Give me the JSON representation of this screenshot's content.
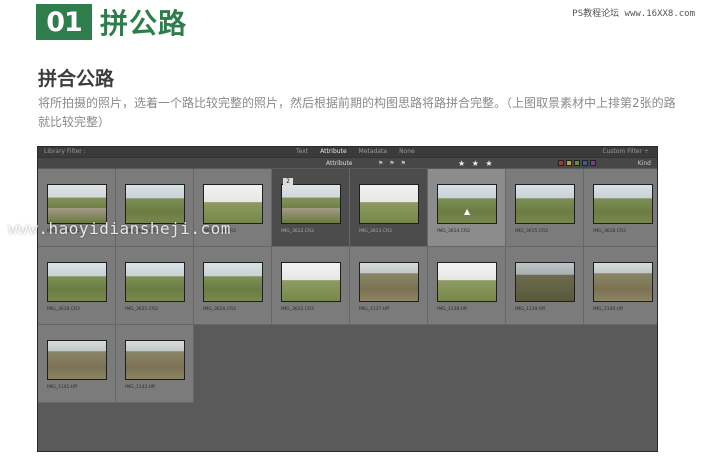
{
  "header": {
    "step_number": "01",
    "title": "拼公路",
    "accent_color": "#2f7d4c"
  },
  "watermark_top": "PS教程论坛 www.16XX8.com",
  "section": {
    "title": "拼合公路",
    "description": "将所拍摄的照片，选着一个路比较完整的照片，然后根据前期的构图思路将路拼合完整。（上图取景素材中上排第2张的路就比较完整）"
  },
  "library": {
    "filter_title": "Library Filter :",
    "filter_tabs": [
      "Text",
      "Attribute",
      "Metadata",
      "None"
    ],
    "active_tab": "Attribute",
    "filter_preset": "Custom Filter ÷",
    "attribute_label": "Attribute",
    "flag_label": "Flag",
    "rating_label": "Rating",
    "rating_stars": "★ ★ ★",
    "color_label": "Color",
    "kind_label": "Kind",
    "swatch_colors": [
      "#9c3b3b",
      "#b8a23a",
      "#5f8f3a",
      "#3a5f8f",
      "#7a3a8f"
    ],
    "thumbnails": [
      {
        "name": "IMG_3608.CR2",
        "style": "t-road",
        "state": ""
      },
      {
        "name": "IMG_3611.CR2",
        "style": "",
        "state": ""
      },
      {
        "name": "IMG_3610.CR2",
        "style": "t-bright",
        "state": ""
      },
      {
        "name": "IMG_3612.CR2",
        "style": "t-road",
        "state": "selected",
        "badge": "2"
      },
      {
        "name": "IMG_3613.CR2",
        "style": "t-bright",
        "state": "selected"
      },
      {
        "name": "IMG_3614.CR2",
        "style": "",
        "state": "hover"
      },
      {
        "name": "IMG_3615.CR2",
        "style": "",
        "state": ""
      },
      {
        "name": "IMG_3616.CR2",
        "style": "",
        "state": ""
      },
      {
        "name": "IMG_3618.CR2",
        "style": "",
        "state": ""
      },
      {
        "name": "IMG_3621.CR2",
        "style": "",
        "state": ""
      },
      {
        "name": "IMG_3620.CR2",
        "style": "",
        "state": ""
      },
      {
        "name": "IMG_3622.CR2",
        "style": "t-bright",
        "state": ""
      },
      {
        "name": "IMG_1137.tiff",
        "style": "t-dry",
        "state": ""
      },
      {
        "name": "IMG_1138.tiff",
        "style": "t-bright",
        "state": ""
      },
      {
        "name": "IMG_1139.tiff",
        "style": "t-dark",
        "state": ""
      },
      {
        "name": "IMG_1140.tiff",
        "style": "t-dry",
        "state": ""
      },
      {
        "name": "IMG_1141.tiff",
        "style": "t-dry",
        "state": ""
      },
      {
        "name": "IMG_1142.tiff",
        "style": "t-dry",
        "state": ""
      }
    ]
  },
  "watermark_mid": "www.haoyidiansheji.com"
}
